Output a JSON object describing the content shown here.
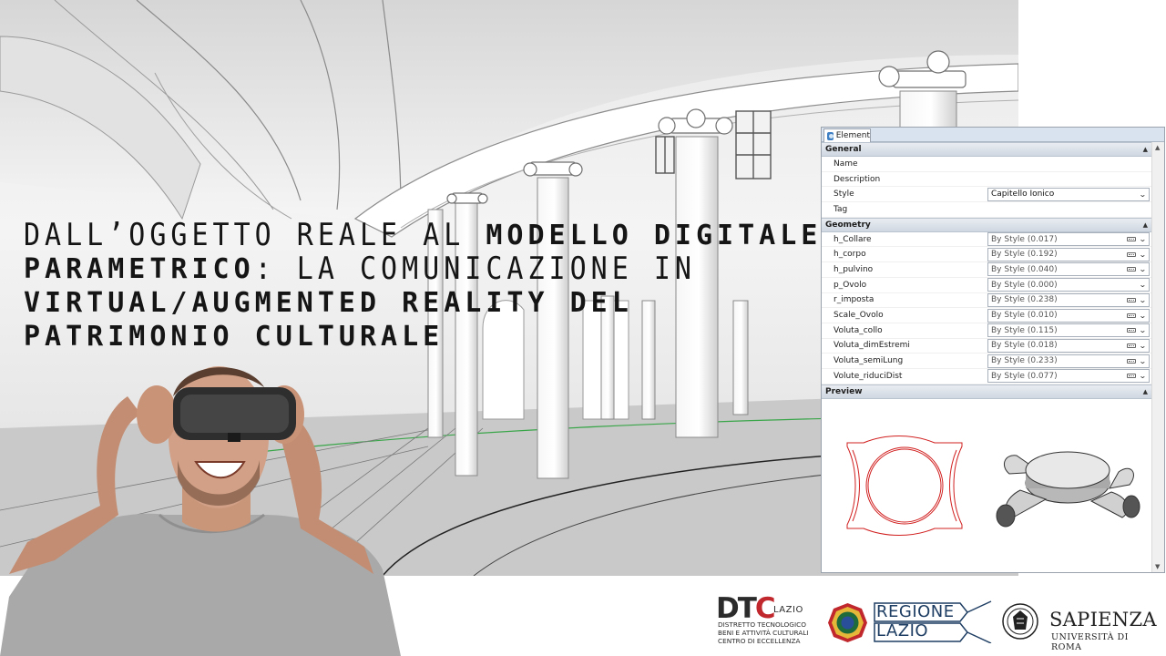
{
  "title": {
    "segments": [
      {
        "text": "DALL’OGGETTO REALE AL ",
        "style": "light"
      },
      {
        "text": "MODELLO DIGITALE PARAMETRICO",
        "style": "bold"
      },
      {
        "text": ": LA COMUNICAZIONE IN ",
        "style": "light"
      },
      {
        "text": "VIRTUAL/AUGMENTED REALITY DEL PATRIMONIO CULTURALE",
        "style": "bold"
      }
    ]
  },
  "panel": {
    "tab_label": "Element",
    "sections": {
      "general": {
        "label": "General",
        "rows": [
          {
            "name": "Name",
            "value": ""
          },
          {
            "name": "Description",
            "value": ""
          },
          {
            "name": "Style",
            "value": "Capitello Ionico"
          },
          {
            "name": "Tag",
            "value": ""
          }
        ]
      },
      "geometry": {
        "label": "Geometry",
        "rows": [
          {
            "name": "h_Collare",
            "value": "By Style (0.017)"
          },
          {
            "name": "h_corpo",
            "value": "By Style (0.192)"
          },
          {
            "name": "h_pulvino",
            "value": "By Style (0.040)"
          },
          {
            "name": "p_Ovolo",
            "value": "By Style (0.000)"
          },
          {
            "name": "r_imposta",
            "value": "By Style (0.238)"
          },
          {
            "name": "Scale_Ovolo",
            "value": "By Style (0.010)"
          },
          {
            "name": "Voluta_collo",
            "value": "By Style (0.115)"
          },
          {
            "name": "Voluta_dimEstremi",
            "value": "By Style (0.018)"
          },
          {
            "name": "Voluta_semiLung",
            "value": "By Style (0.233)"
          },
          {
            "name": "Volute_riduciDist",
            "value": "By Style (0.077)"
          }
        ]
      },
      "preview": {
        "label": "Preview"
      }
    }
  },
  "logos": {
    "dtc": {
      "mark_d": "D",
      "mark_t": "T",
      "mark_c": "C",
      "lazio": "LAZIO",
      "line1": "DISTRETTO TECNOLOGICO",
      "line2": "BENI E ATTIVITÀ CULTURALI",
      "line3": "CENTRO DI ECCELLENZA"
    },
    "regione": {
      "line1": "REGIONE",
      "line2": "LAZIO"
    },
    "sapienza": {
      "name": "SAPIENZA",
      "sub": "UNIVERSITÀ DI ROMA"
    }
  },
  "colors": {
    "accent_red": "#c0282d",
    "regione_blue": "#1f3e63",
    "panel_header": "#d9e3ef"
  }
}
